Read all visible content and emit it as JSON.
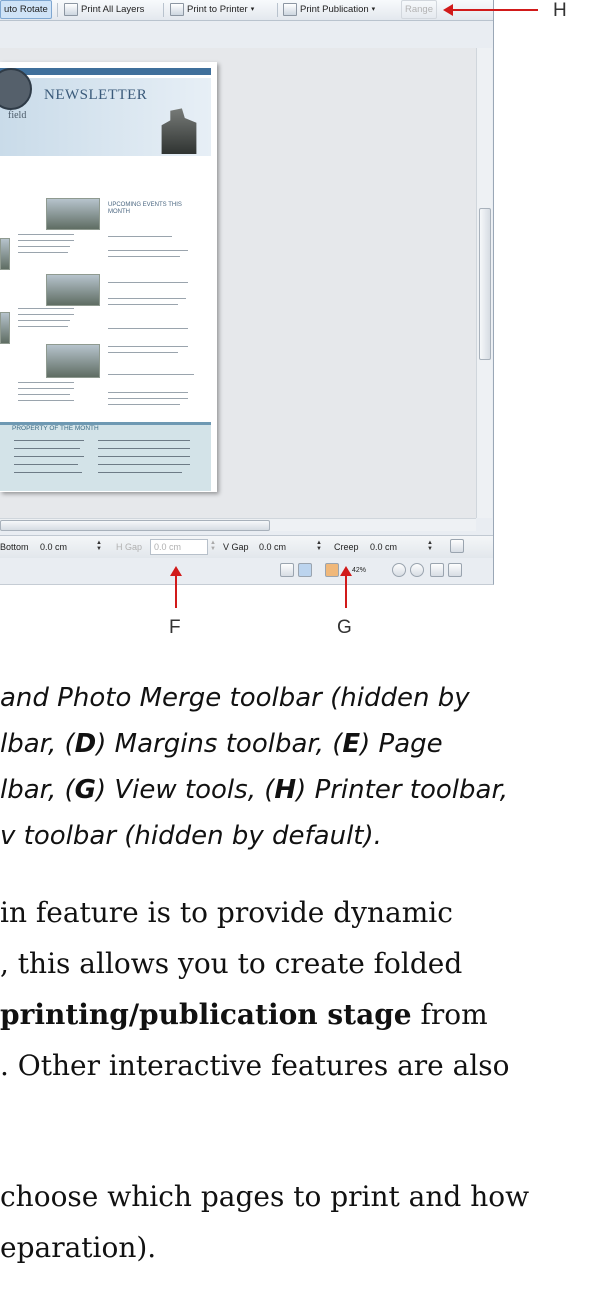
{
  "toolbar": {
    "auto_rotate": "uto Rotate",
    "print_all_layers": "Print All Layers",
    "print_to_printer": "Print to Printer",
    "print_publication": "Print Publication",
    "range": "Range"
  },
  "newsletter": {
    "title": "NEWSLETTER",
    "logo_text": "field",
    "upcoming": "UPCOMING EVENTS THIS MONTH",
    "property": "PROPERTY OF THE MONTH"
  },
  "margins_toolbar": {
    "bottom_label": "Bottom",
    "bottom_value": "0.0 cm",
    "hgap_label": "H Gap",
    "hgap_value": "0.0 cm",
    "vgap_label": "V Gap",
    "vgap_value": "0.0 cm",
    "creep_label": "Creep",
    "creep_value": "0.0 cm"
  },
  "view_tools": {
    "zoom": "42%"
  },
  "labels": {
    "H": "H",
    "F": "F",
    "G": "G"
  },
  "caption": {
    "line1": "and Photo Merge toolbar (hidden by",
    "line2_a": "lbar, (",
    "line2_b": "D",
    "line2_c": ") Margins toolbar, (",
    "line2_d": "E",
    "line2_e": ") Page",
    "line3_a": "lbar, (",
    "line3_b": "G",
    "line3_c": ") View tools, (",
    "line3_d": "H",
    "line3_e": ") Printer toolbar,",
    "line4": "v toolbar (hidden by default)."
  },
  "body": {
    "line1": "in feature is to provide dynamic",
    "line2": ", this allows you to create folded",
    "line3_bold": "printing/publication stage",
    "line3_rest": " from",
    "line4": ". Other interactive features are also",
    "line5": "choose which pages to print and how",
    "line6": "eparation)."
  },
  "colors": {
    "accent_red": "#d11a1a",
    "newsletter_blue": "#3f6f9b"
  }
}
